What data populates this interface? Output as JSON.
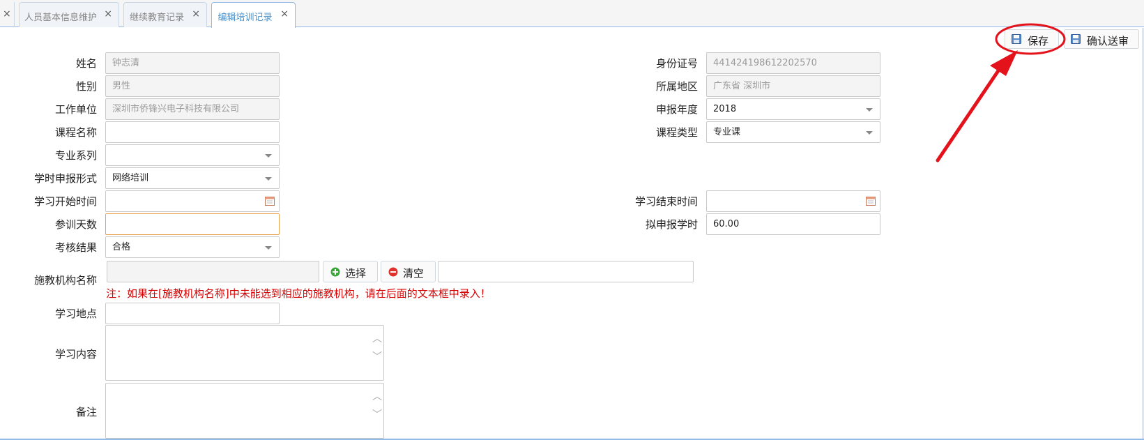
{
  "tabs": [
    {
      "label": "人员基本信息维护",
      "close": "×"
    },
    {
      "label": "继续教育记录",
      "close": "×"
    },
    {
      "label": "编辑培训记录",
      "close": "×"
    }
  ],
  "leading_tab_close": "×",
  "toolbar": {
    "save_label": "保存",
    "confirm_label": "确认送审",
    "icon": "floppy-disk-icon"
  },
  "form": {
    "name": {
      "label": "姓名",
      "value": "钟志清"
    },
    "gender": {
      "label": "性别",
      "value": "男性"
    },
    "employer": {
      "label": "工作单位",
      "value": "深圳市侨锋兴电子科技有限公司"
    },
    "course_name": {
      "label": "课程名称",
      "value": ""
    },
    "major_series": {
      "label": "专业系列",
      "value": ""
    },
    "hours_form": {
      "label": "学时申报形式",
      "value": "网络培训"
    },
    "start_time": {
      "label": "学习开始时间",
      "value": ""
    },
    "training_days": {
      "label": "参训天数",
      "value": ""
    },
    "assessment": {
      "label": "考核结果",
      "value": "合格"
    },
    "institution": {
      "label": "施教机构名称",
      "value": "",
      "manual_value": ""
    },
    "location": {
      "label": "学习地点",
      "value": ""
    },
    "content": {
      "label": "学习内容",
      "value": ""
    },
    "remarks": {
      "label": "备注",
      "value": ""
    },
    "id_number": {
      "label": "身份证号",
      "value": "441424198612202570"
    },
    "region": {
      "label": "所属地区",
      "value": "广东省 深圳市"
    },
    "report_year": {
      "label": "申报年度",
      "value": "2018"
    },
    "course_type": {
      "label": "课程类型",
      "value": "专业课"
    },
    "end_time": {
      "label": "学习结束时间",
      "value": ""
    },
    "planned_hours": {
      "label": "拟申报学时",
      "value": "60.00"
    }
  },
  "buttons": {
    "select_label": "选择",
    "clear_label": "清空"
  },
  "note": "注：如果在[施教机构名称]中未能选到相应的施教机构，请在后面的文本框中录入！",
  "annotation": {
    "color": "#e3121b",
    "target": "保存"
  }
}
